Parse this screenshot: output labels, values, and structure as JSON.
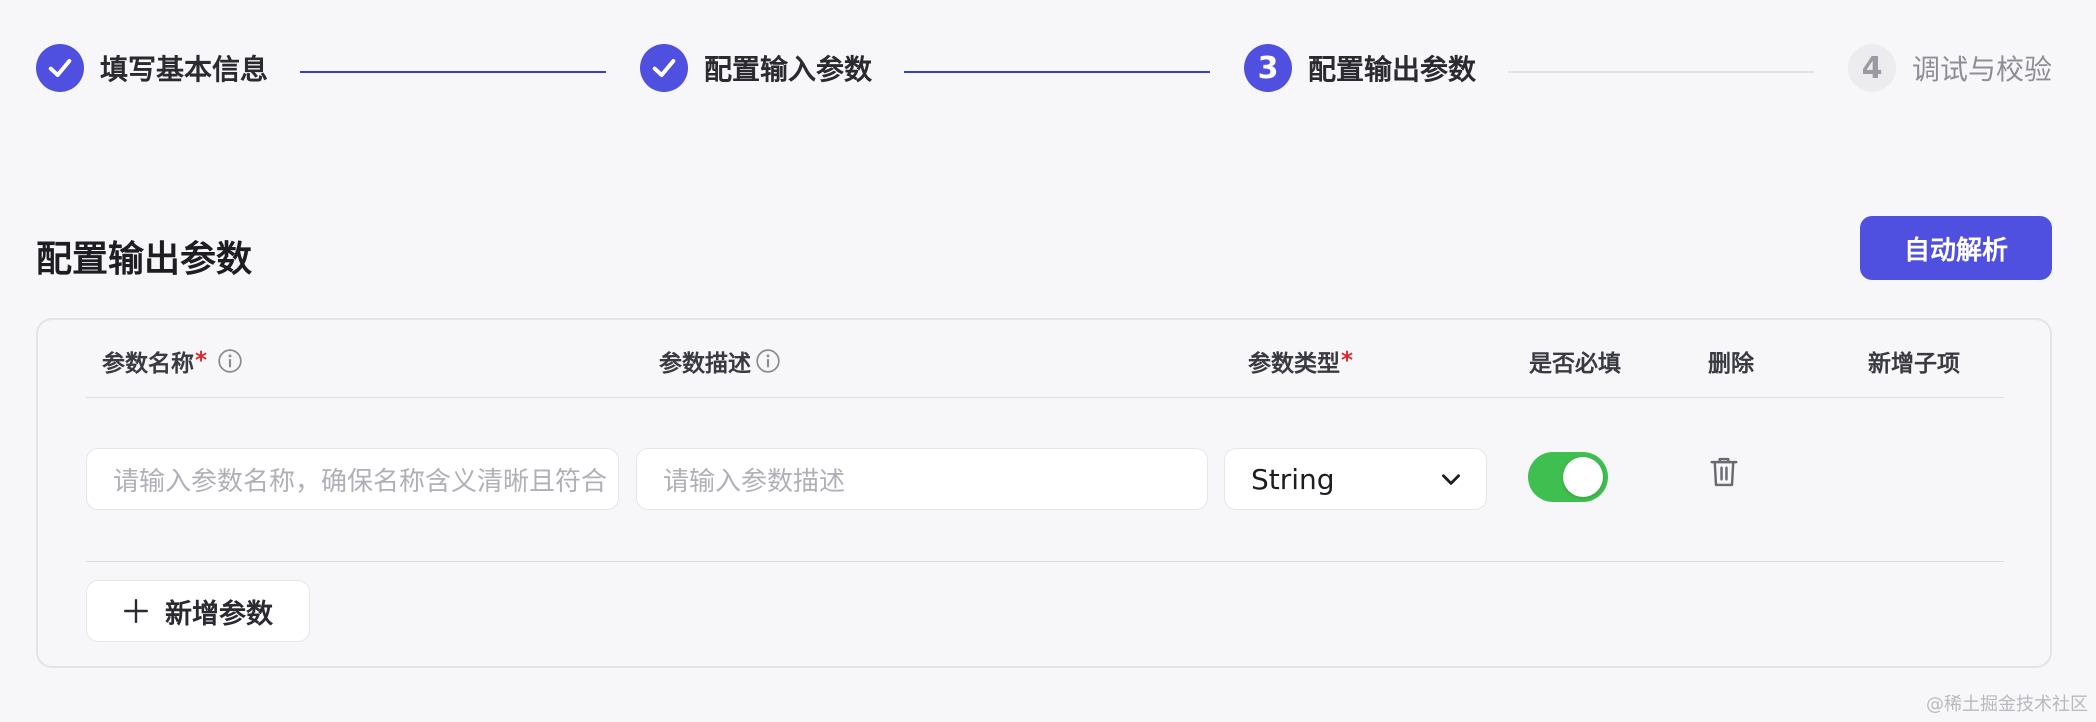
{
  "stepper": {
    "steps": [
      {
        "label": "填写基本信息",
        "status": "done"
      },
      {
        "label": "配置输入参数",
        "status": "done"
      },
      {
        "label": "配置输出参数",
        "status": "active",
        "number": "3"
      },
      {
        "label": "调试与校验",
        "status": "pending",
        "number": "4"
      }
    ]
  },
  "section": {
    "title": "配置输出参数",
    "auto_parse_label": "自动解析"
  },
  "table": {
    "columns": {
      "name": "参数名称",
      "description": "参数描述",
      "type": "参数类型",
      "required": "是否必填",
      "delete": "删除",
      "add_child": "新增子项"
    },
    "required_mark": "*",
    "row": {
      "name_placeholder": "请输入参数名称，确保名称含义清晰且符合",
      "description_placeholder": "请输入参数描述",
      "type_value": "String",
      "required": true
    },
    "add_param_label": "新增参数"
  },
  "watermark": "@稀土掘金技术社区",
  "colors": {
    "primary": "#4f4fe0",
    "toggle_on": "#3fbf4f",
    "required_mark": "#e0242c",
    "background": "#f7f7f9"
  },
  "icons": {
    "done_step": "check-icon",
    "info": "info-icon",
    "dropdown": "chevron-down-icon",
    "delete": "trash-icon",
    "add": "plus-icon"
  }
}
